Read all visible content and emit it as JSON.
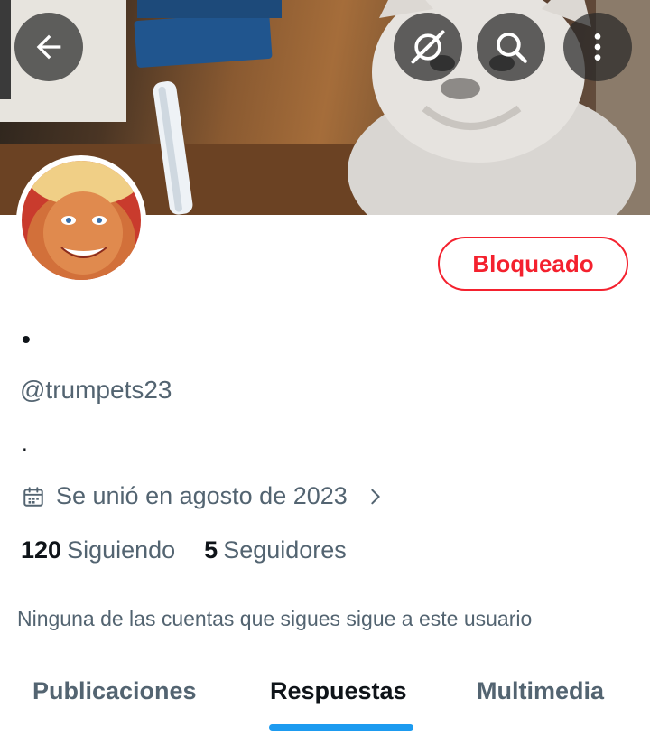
{
  "header": {
    "back_icon": "arrow-left-icon",
    "grok_icon": "grok-icon",
    "search_icon": "search-icon",
    "more_icon": "more-vertical-icon",
    "banner_subject": "kitten"
  },
  "profile": {
    "display_name": "•",
    "handle": "@trumpets23",
    "bio": ".",
    "joined": "Se unió en agosto de 2023",
    "following_count": "120",
    "following_label": "Siguiendo",
    "followers_count": "5",
    "followers_label": "Seguidores",
    "followers_note": "Ninguna de las cuentas que sigues sigue a este usuario"
  },
  "actions": {
    "blocked_label": "Bloqueado"
  },
  "tabs": [
    {
      "label": "Publicaciones",
      "active": false
    },
    {
      "label": "Respuestas",
      "active": true
    },
    {
      "label": "Multimedia",
      "active": false
    }
  ],
  "colors": {
    "accent": "#1d9bf0",
    "blocked": "#f4212e",
    "text_primary": "#0f1419",
    "text_secondary": "#536471"
  }
}
